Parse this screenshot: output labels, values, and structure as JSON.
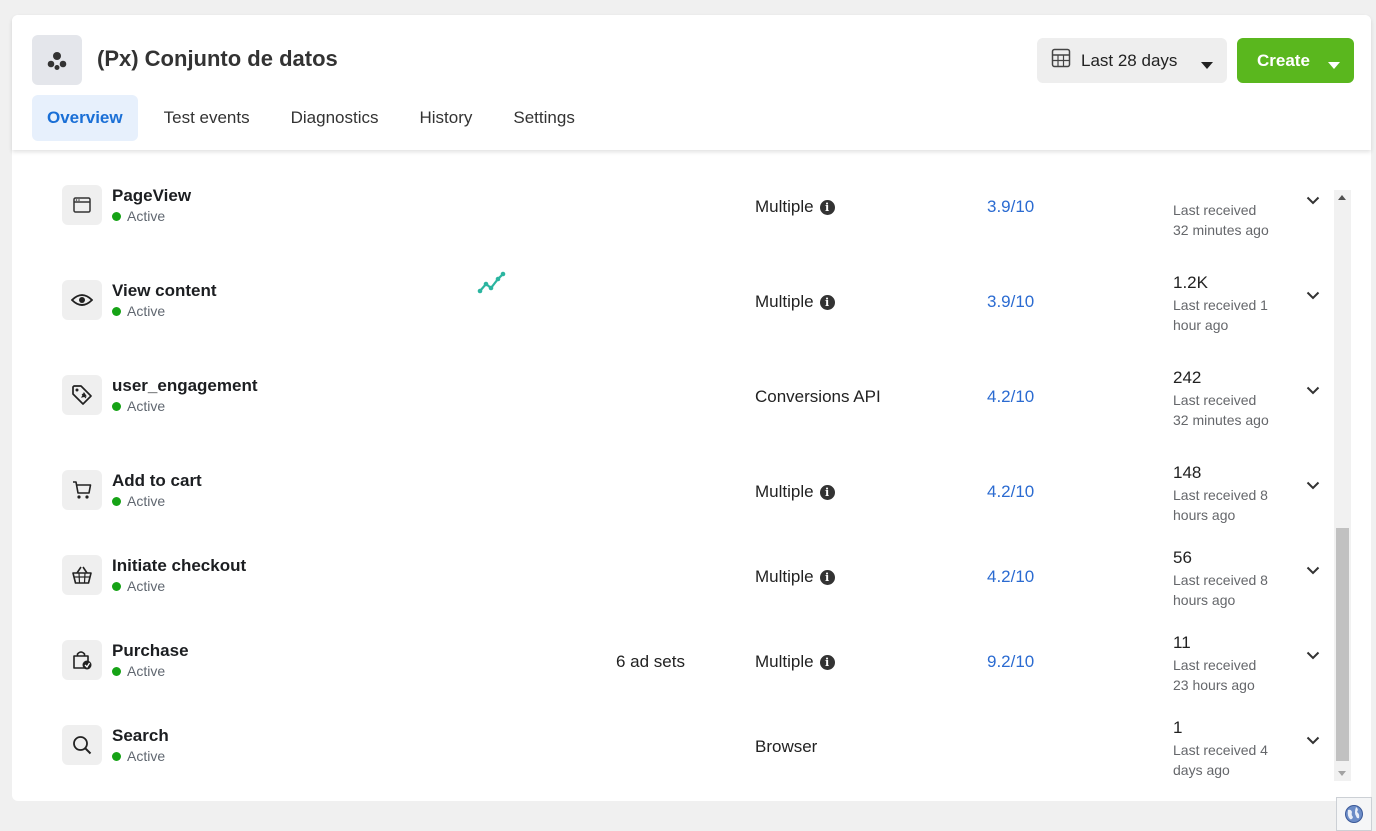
{
  "header": {
    "title": "(Px) Conjunto de datos",
    "date_range_label": "Last 28 days",
    "create_label": "Create"
  },
  "tabs": [
    {
      "label": "Overview",
      "active": true
    },
    {
      "label": "Test events",
      "active": false
    },
    {
      "label": "Diagnostics",
      "active": false
    },
    {
      "label": "History",
      "active": false
    },
    {
      "label": "Settings",
      "active": false
    }
  ],
  "events": [
    {
      "name": "PageView",
      "status": "Active",
      "icon": "browser-window-icon",
      "ad_sets": "",
      "source": "Multiple",
      "source_info": true,
      "score": "3.9/10",
      "count": "",
      "received": "Last received 32 minutes ago"
    },
    {
      "name": "View content",
      "status": "Active",
      "icon": "eye-icon",
      "ad_sets": "",
      "source": "Multiple",
      "source_info": true,
      "score": "3.9/10",
      "count": "1.2K",
      "received": "Last received 1 hour ago"
    },
    {
      "name": "user_engagement",
      "status": "Active",
      "icon": "tag-icon",
      "ad_sets": "",
      "source": "Conversions API",
      "source_info": false,
      "score": "4.2/10",
      "count": "242",
      "received": "Last received 32 minutes ago"
    },
    {
      "name": "Add to cart",
      "status": "Active",
      "icon": "cart-icon",
      "ad_sets": "",
      "source": "Multiple",
      "source_info": true,
      "score": "4.2/10",
      "count": "148",
      "received": "Last received 8 hours ago"
    },
    {
      "name": "Initiate checkout",
      "status": "Active",
      "icon": "basket-icon",
      "ad_sets": "",
      "source": "Multiple",
      "source_info": true,
      "score": "4.2/10",
      "count": "56",
      "received": "Last received 8 hours ago"
    },
    {
      "name": "Purchase",
      "status": "Active",
      "icon": "shopping-bag-icon",
      "ad_sets": "6 ad sets",
      "source": "Multiple",
      "source_info": true,
      "score": "9.2/10",
      "count": "11",
      "received": "Last received 23 hours ago"
    },
    {
      "name": "Search",
      "status": "Active",
      "icon": "search-icon",
      "ad_sets": "",
      "source": "Browser",
      "source_info": false,
      "score": "",
      "count": "1",
      "received": "Last received 4 days ago"
    }
  ],
  "colors": {
    "accent_blue": "#1a6fd6",
    "create_green": "#5ab71e",
    "active_dot": "#16a316",
    "trend_teal": "#2bb5a0"
  }
}
